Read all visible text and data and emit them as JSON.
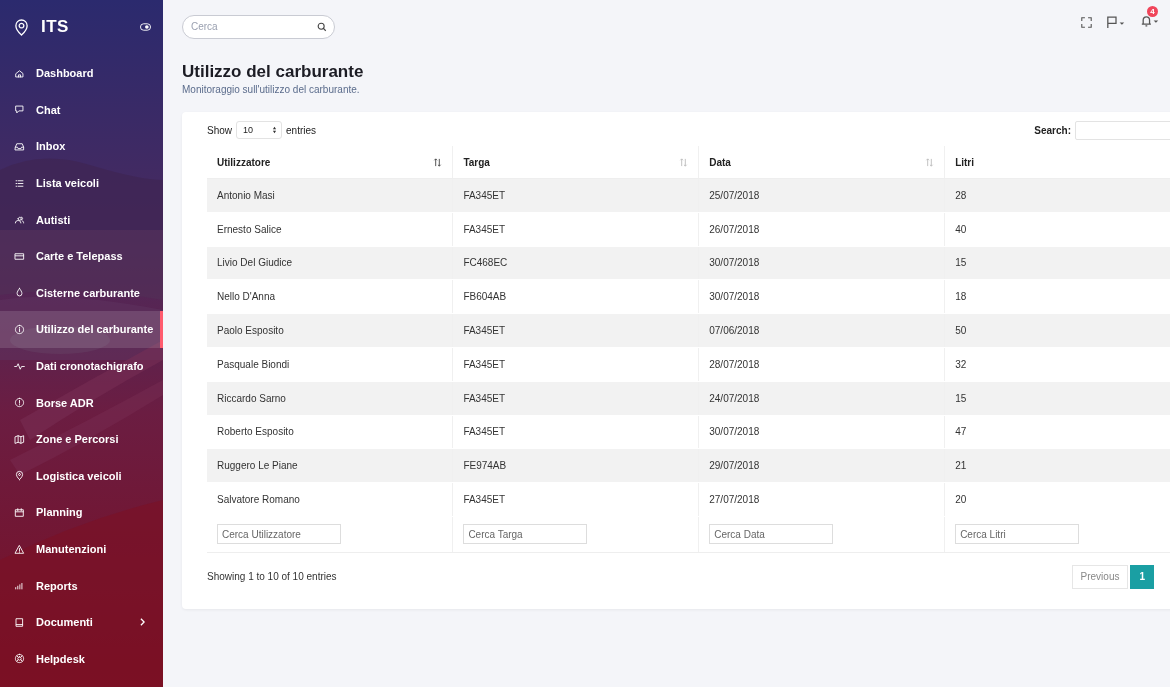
{
  "sidebar": {
    "brand": "ITS",
    "items": [
      {
        "label": "Dashboard",
        "selected": false,
        "has_submenu": false
      },
      {
        "label": "Chat",
        "selected": false,
        "has_submenu": false
      },
      {
        "label": "Inbox",
        "selected": false,
        "has_submenu": false
      },
      {
        "label": "Lista veicoli",
        "selected": false,
        "has_submenu": false
      },
      {
        "label": "Autisti",
        "selected": false,
        "has_submenu": false
      },
      {
        "label": "Carte e Telepass",
        "selected": false,
        "has_submenu": false
      },
      {
        "label": "Cisterne carburante",
        "selected": false,
        "has_submenu": false
      },
      {
        "label": "Utilizzo del carburante",
        "selected": true,
        "has_submenu": false
      },
      {
        "label": "Dati cronotachigrafo",
        "selected": false,
        "has_submenu": false
      },
      {
        "label": "Borse ADR",
        "selected": false,
        "has_submenu": false
      },
      {
        "label": "Zone e Percorsi",
        "selected": false,
        "has_submenu": false
      },
      {
        "label": "Logistica veicoli",
        "selected": false,
        "has_submenu": false
      },
      {
        "label": "Planning",
        "selected": false,
        "has_submenu": false
      },
      {
        "label": "Manutenzioni",
        "selected": false,
        "has_submenu": false
      },
      {
        "label": "Reports",
        "selected": false,
        "has_submenu": false
      },
      {
        "label": "Documenti",
        "selected": false,
        "has_submenu": true
      },
      {
        "label": "Helpdesk",
        "selected": false,
        "has_submenu": false
      }
    ]
  },
  "topbar": {
    "search": {
      "placeholder": "Cerca"
    },
    "notifications_count": "4"
  },
  "page": {
    "title": "Utilizzo del carburante",
    "subtitle": "Monitoraggio sull'utilizzo del carburante."
  },
  "table": {
    "show_label": "Show",
    "page_size": "10",
    "entries_label": "entries",
    "search_label": "Search:",
    "columns": [
      {
        "label": "Utilizzatore",
        "sorted": true
      },
      {
        "label": "Targa",
        "sorted": false
      },
      {
        "label": "Data",
        "sorted": false
      },
      {
        "label": "Litri"
      }
    ],
    "rows": [
      [
        "Antonio Masi",
        "FA345ET",
        "25/07/2018",
        "28"
      ],
      [
        "Ernesto Salice",
        "FA345ET",
        "26/07/2018",
        "40"
      ],
      [
        "Livio Del Giudice",
        "FC468EC",
        "30/07/2018",
        "15"
      ],
      [
        "Nello D'Anna",
        "FB604AB",
        "30/07/2018",
        "18"
      ],
      [
        "Paolo Esposito",
        "FA345ET",
        "07/06/2018",
        "50"
      ],
      [
        "Pasquale Biondi",
        "FA345ET",
        "28/07/2018",
        "32"
      ],
      [
        "Riccardo Sarno",
        "FA345ET",
        "24/07/2018",
        "15"
      ],
      [
        "Roberto Esposito",
        "FA345ET",
        "30/07/2018",
        "47"
      ],
      [
        "Ruggero Le Piane",
        "FE974AB",
        "29/07/2018",
        "21"
      ],
      [
        "Salvatore Romano",
        "FA345ET",
        "27/07/2018",
        "20"
      ]
    ],
    "filters": [
      {
        "placeholder": "Cerca Utilizzatore"
      },
      {
        "placeholder": "Cerca Targa"
      },
      {
        "placeholder": "Cerca Data"
      },
      {
        "placeholder": "Cerca Litri"
      }
    ],
    "info": "Showing 1 to 10 of 10 entries",
    "pagination": [
      {
        "label": "Previous",
        "selected": false
      },
      {
        "label": "1",
        "selected": true
      }
    ]
  }
}
